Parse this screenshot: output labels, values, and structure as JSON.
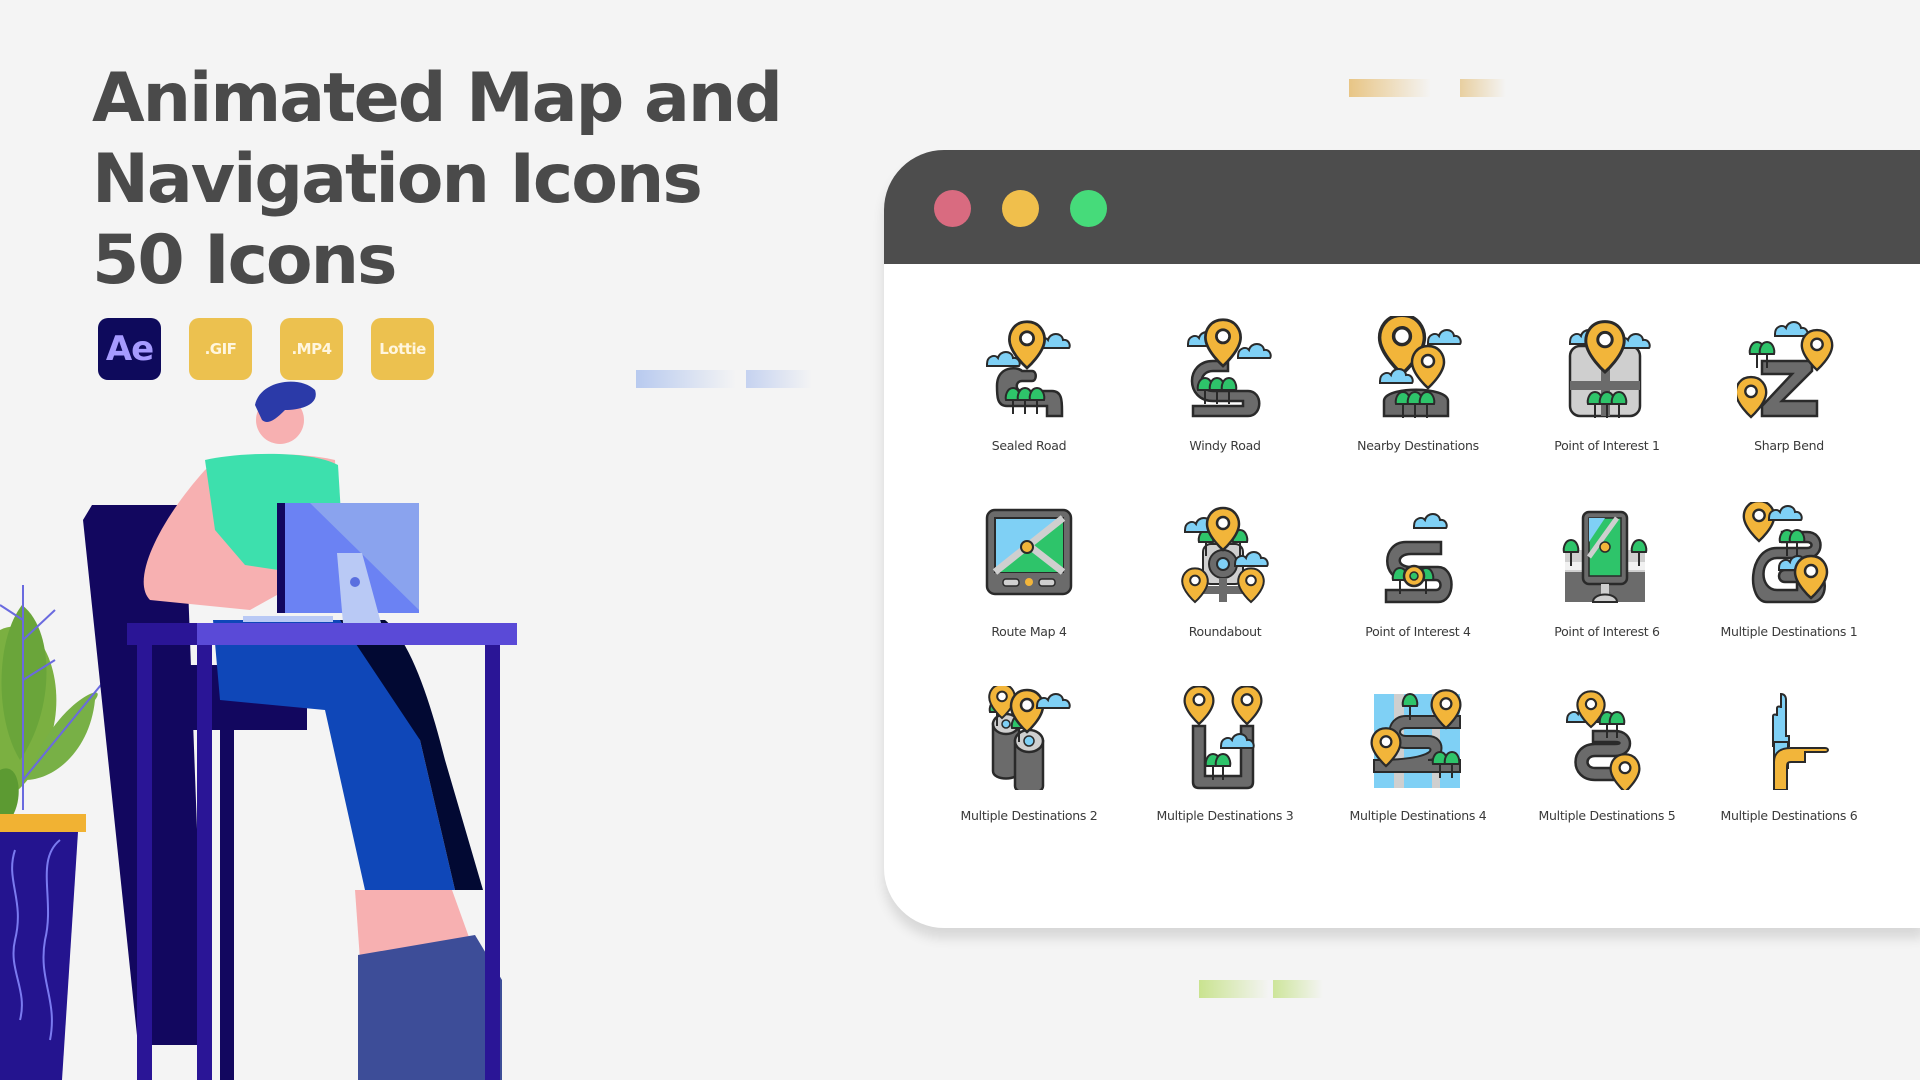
{
  "hero": {
    "title_lines": [
      "Animated Map and",
      "Navigation Icons",
      "50 Icons"
    ]
  },
  "badges": [
    {
      "label": "Ae",
      "kind": "after-effects"
    },
    {
      "label": ".GIF",
      "kind": "format"
    },
    {
      "label": ".MP4",
      "kind": "format"
    },
    {
      "label": "Lottie",
      "kind": "format"
    }
  ],
  "window": {
    "controls": [
      {
        "name": "close",
        "color": "#d96b80"
      },
      {
        "name": "minimize",
        "color": "#f0bf4c"
      },
      {
        "name": "maximize",
        "color": "#46db7a"
      }
    ],
    "icons": [
      {
        "label": "Sealed Road",
        "icon": "sealed-road-icon"
      },
      {
        "label": "Windy Road",
        "icon": "windy-road-icon"
      },
      {
        "label": "Nearby Destinations",
        "icon": "nearby-destinations-icon"
      },
      {
        "label": "Point of Interest 1",
        "icon": "point-of-interest-1-icon"
      },
      {
        "label": "Sharp Bend",
        "icon": "sharp-bend-icon"
      },
      {
        "label": "Route Map 4",
        "icon": "route-map-4-icon"
      },
      {
        "label": "Roundabout",
        "icon": "roundabout-icon"
      },
      {
        "label": "Point of Interest 4",
        "icon": "point-of-interest-4-icon"
      },
      {
        "label": "Point of Interest 6",
        "icon": "point-of-interest-6-icon"
      },
      {
        "label": "Multiple Destinations 1",
        "icon": "multiple-destinations-1-icon"
      },
      {
        "label": "Multiple Destinations 2",
        "icon": "multiple-destinations-2-icon"
      },
      {
        "label": "Multiple Destinations 3",
        "icon": "multiple-destinations-3-icon"
      },
      {
        "label": "Multiple Destinations 4",
        "icon": "multiple-destinations-4-icon"
      },
      {
        "label": "Multiple Destinations 5",
        "icon": "multiple-destinations-5-icon"
      },
      {
        "label": "Multiple Destinations 6",
        "icon": "multiple-destinations-6-icon"
      }
    ]
  },
  "colors": {
    "background": "#f4f4f4",
    "title_text": "#4a4a4a",
    "titlebar": "#4d4d4d",
    "ae_badge": "#0e0a5c",
    "format_badge": "#ecc14f",
    "pin": "#f2b53a",
    "road": "#6b6b6b",
    "tree": "#2ec46a",
    "cloud": "#7fd0f5"
  }
}
